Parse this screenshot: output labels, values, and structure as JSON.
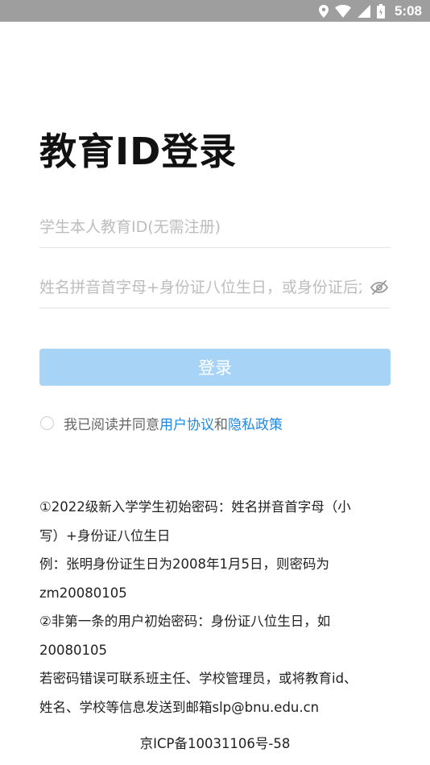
{
  "status_bar": {
    "time": "5:08",
    "icons": [
      "location-icon",
      "wifi-icon",
      "signal-icon",
      "battery-icon"
    ],
    "background": "#9e9e9e"
  },
  "login": {
    "title": "教育ID登录",
    "id_placeholder": "学生本人教育ID(无需注册)",
    "password_placeholder": "姓名拼音首字母+身份证八位生日，或身份证后六位",
    "password_toggle_icon": "eye-off-icon",
    "button_label": "登录",
    "button_color": "#a6d3f6"
  },
  "agreement": {
    "checked": false,
    "prefix": "我已阅读并同意",
    "user_agreement": "用户协议",
    "conjunction": "和",
    "privacy_policy": "隐私政策",
    "link_color": "#1e88e5"
  },
  "notes": {
    "lines": [
      "①2022级新入学学生初始密码：姓名拼音首字母（小",
      "写）+身份证八位生日",
      "例：张明身份证生日为2008年1月5日，则密码为",
      "zm20080105",
      "②非第一条的用户初始密码：身份证八位生日，如",
      "20080105",
      "若密码错误可联系班主任、学校管理员，或将教育id、",
      "姓名、学校等信息发送到邮箱slp@bnu.edu.cn"
    ]
  },
  "footer": {
    "icp": "京ICP备10031106号-58"
  }
}
